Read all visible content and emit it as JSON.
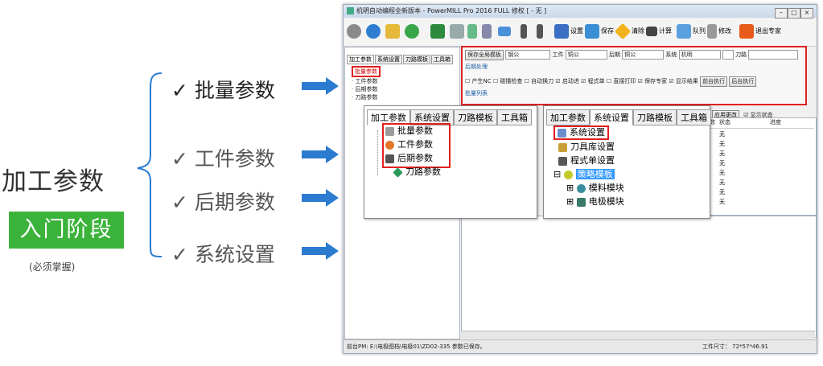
{
  "annotation": {
    "main_title": "加工参数",
    "stage_badge": "入门阶段",
    "stage_note": "(必须掌握)",
    "check_items": [
      "✓ 批量参数",
      "✓ 工件参数",
      "✓ 后期参数",
      "✓ 系统设置"
    ],
    "accent_color": "#2b7bd0",
    "badge_color": "#3bb33b"
  },
  "window": {
    "title": "机明自动编程全新版本 - PowerMILL Pro 2016 FULL 修权  [ - 无 ]",
    "toolbar": [
      "设置",
      "保存",
      "清除",
      "计算",
      "队列",
      "修改",
      "退出专家"
    ],
    "left_tabs": [
      "加工参数",
      "系统设置",
      "刀路模板",
      "工具箱"
    ],
    "left_tree": [
      "批量参数",
      "工件参数",
      "后期参数",
      "刀路参数"
    ],
    "config_row1": {
      "btn": "保存全局模板",
      "material_value": "钢公",
      "workpiece_label": "工件",
      "workpiece_value": "铜公",
      "post_label": "后期",
      "post_value": "铜公",
      "system_label": "系统",
      "system_value": "机明",
      "tool_label": "刀路"
    },
    "post_processing": "后期处理",
    "options": [
      "产生NC",
      "碰撞检查",
      "自动换刀",
      "启动进",
      "程式单",
      "直接打印",
      "保存专家",
      "显示结果"
    ],
    "run_buttons": [
      "前台执行",
      "后台执行"
    ],
    "batch_list": "批量列表",
    "apply_button": "应用更改",
    "show_status": "显示状态",
    "grid_headers": [
      "数",
      "状态",
      "进度"
    ],
    "grid_rows": [
      "无",
      "无",
      "无",
      "无",
      "无",
      "无",
      "无",
      "无"
    ],
    "status_left": "前台PM: E:\\电极图档\\电极01\\ZD02-335 参数已保存。",
    "status_right": "工件尺寸：  72*57*46.91"
  },
  "zoom_left": {
    "tabs": [
      "加工参数",
      "系统设置",
      "刀路模板",
      "工具箱"
    ],
    "items": [
      "批量参数",
      "工件参数",
      "后期参数",
      "刀路参数"
    ]
  },
  "zoom_right": {
    "tabs": [
      "加工参数",
      "系统设置",
      "刀路模板",
      "工具箱"
    ],
    "items": [
      "系统设置",
      "刀具库设置",
      "程式单设置",
      "策略模板",
      "模料模块",
      "电极模块"
    ]
  }
}
